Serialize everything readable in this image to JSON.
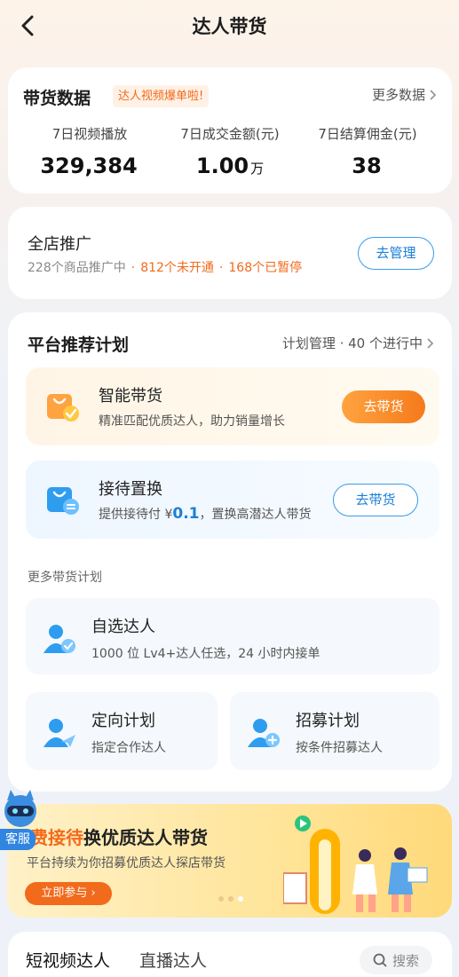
{
  "header": {
    "title": "达人带货"
  },
  "sales_data": {
    "title": "带货数据",
    "badge": "达人视频爆单啦!",
    "more_link": "更多数据",
    "stats": [
      {
        "label": "7日视频播放",
        "value": "329,384",
        "unit": ""
      },
      {
        "label": "7日成交金额(元)",
        "value": "1.00",
        "unit": "万"
      },
      {
        "label": "7日结算佣金(元)",
        "value": "38",
        "unit": ""
      }
    ]
  },
  "store_promo": {
    "title": "全店推广",
    "products": "228个商品推广中",
    "not_open": "812个未开通",
    "paused": "168个已暂停",
    "button": "去管理"
  },
  "platform_plans": {
    "title": "平台推荐计划",
    "manage_link": "计划管理 · 40 个进行中",
    "plans": [
      {
        "name": "智能带货",
        "desc": "精准匹配优质达人，助力销量增长",
        "button": "去带货"
      },
      {
        "name": "接待置换",
        "desc_prefix": "提供接待付 ¥",
        "desc_amount": "0.1",
        "desc_suffix": "，置换高潜达人带货",
        "button": "去带货"
      }
    ],
    "more_title": "更多带货计划",
    "more_plans": [
      {
        "name": "自选达人",
        "desc": "1000 位 Lv4+达人任选，24 小时内接单"
      },
      {
        "name": "定向计划",
        "desc": "指定合作达人"
      },
      {
        "name": "招募计划",
        "desc": "按条件招募达人"
      }
    ]
  },
  "banner": {
    "title_highlight": "费接待",
    "title_rest": "换优质达人带货",
    "subtitle": "平台持续为你招募优质达人探店带货",
    "button": "立即参与"
  },
  "service": {
    "label": "客服"
  },
  "bottom_tabs": {
    "tab1": "短视频达人",
    "tab2": "直播达人",
    "search": "搜索"
  },
  "colors": {
    "accent_orange": "#f26a1b",
    "accent_blue": "#1b7fd6"
  }
}
